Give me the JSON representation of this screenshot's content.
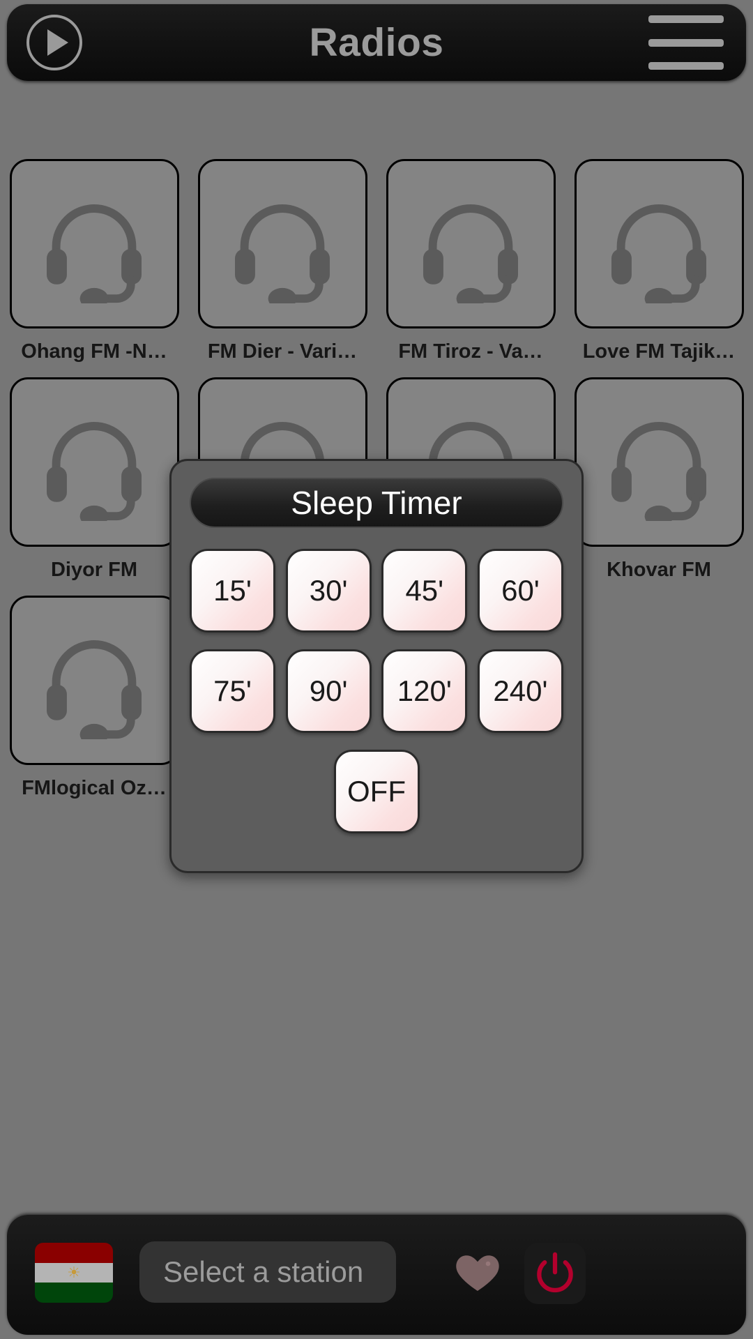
{
  "header": {
    "title": "Radios",
    "play_icon": "play-icon",
    "menu_icon": "hamburger-menu-icon"
  },
  "stations": {
    "placeholder_icon": "headset-icon",
    "rows": [
      [
        {
          "label": "Ohang FM -N…"
        },
        {
          "label": "FM Dier - Vari…"
        },
        {
          "label": "FM Tiroz - Va…"
        },
        {
          "label": "Love FM Tajik…"
        }
      ],
      [
        {
          "label": "Diyor FM"
        },
        {
          "label": ""
        },
        {
          "label": ""
        },
        {
          "label": "Khovar FM"
        }
      ],
      [
        {
          "label": "FMlogical Oz…"
        }
      ]
    ]
  },
  "dialog": {
    "title": "Sleep Timer",
    "rows": [
      [
        "15'",
        "30'",
        "45'",
        "60'"
      ],
      [
        "75'",
        "90'",
        "120'",
        "240'"
      ],
      [
        "OFF"
      ]
    ]
  },
  "bottombar": {
    "flag_name": "tajikistan-flag",
    "flag_emblem": "☀",
    "station_select_value": "Select a station",
    "favorite_icon": "heart-icon",
    "power_icon": "power-icon"
  },
  "colors": {
    "page_background": "#767676",
    "bar_background": "#121212",
    "dialog_background": "#5d5d5d",
    "title_text": "#9b9b9b",
    "timer_button": "#fbe0e0",
    "power_accent": "#b3002d",
    "heart_accent": "#7d6465"
  }
}
